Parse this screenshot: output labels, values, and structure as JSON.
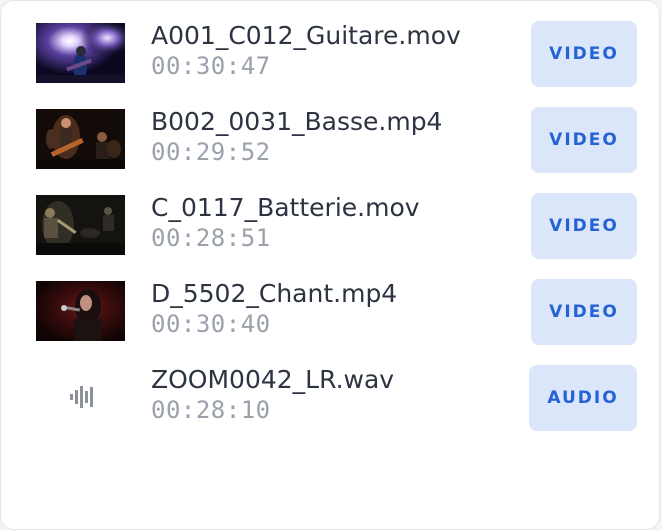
{
  "files": [
    {
      "name": "A001_C012_Guitare.mov",
      "duration": "00:30:47",
      "type": "VIDEO",
      "thumb": "guitar-performance-thumbnail"
    },
    {
      "name": "B002_0031_Basse.mp4",
      "duration": "00:29:52",
      "type": "VIDEO",
      "thumb": "bass-performance-thumbnail"
    },
    {
      "name": "C_0117_Batterie.mov",
      "duration": "00:28:51",
      "type": "VIDEO",
      "thumb": "drums-performance-thumbnail"
    },
    {
      "name": "D_5502_Chant.mp4",
      "duration": "00:30:40",
      "type": "VIDEO",
      "thumb": "vocals-performance-thumbnail"
    },
    {
      "name": "ZOOM0042_LR.wav",
      "duration": "00:28:10",
      "type": "AUDIO",
      "icon": "audio-waveform-icon"
    }
  ],
  "colors": {
    "badge_bg": "#dbe6fb",
    "badge_text": "#2563d4",
    "filename_text": "#2c3442",
    "duration_text": "#9aa1ab"
  }
}
